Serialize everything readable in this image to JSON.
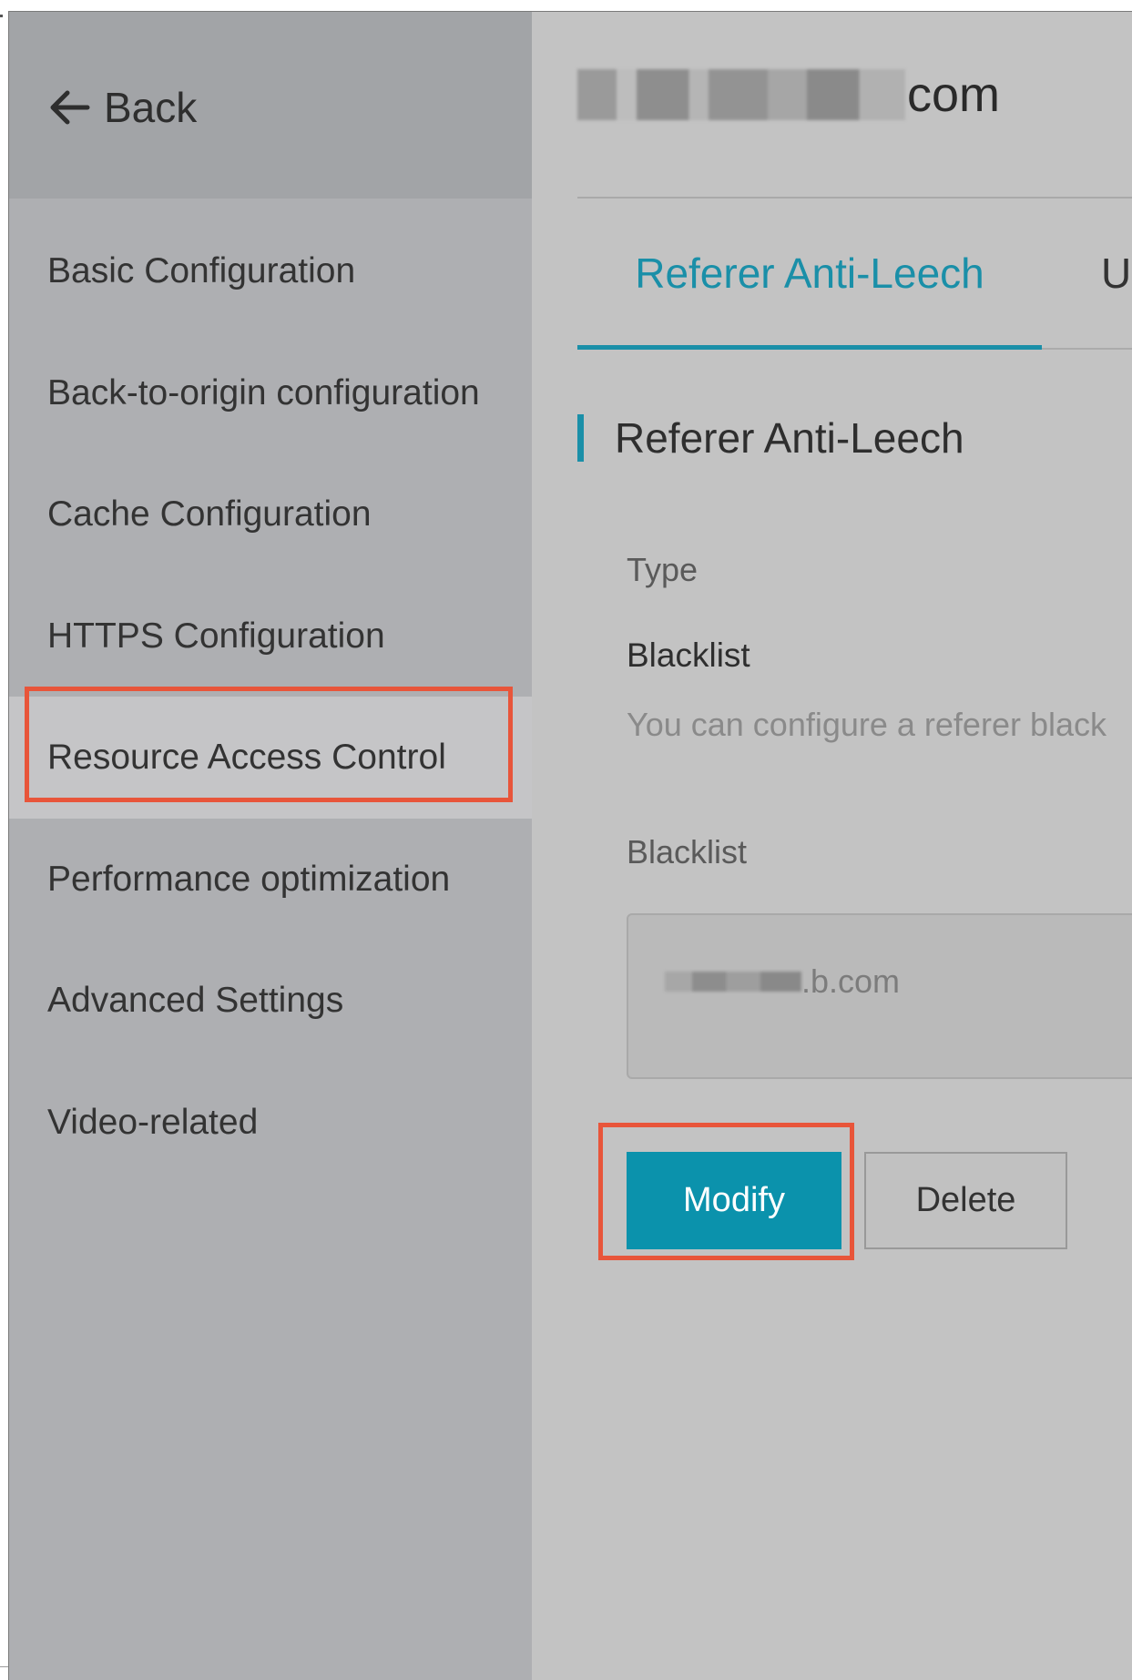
{
  "sidebar": {
    "back_label": "Back",
    "items": [
      {
        "label": "Basic Configuration"
      },
      {
        "label": "Back-to-origin configuration"
      },
      {
        "label": "Cache Configuration"
      },
      {
        "label": "HTTPS Configuration"
      },
      {
        "label": "Resource Access Control"
      },
      {
        "label": "Performance optimization"
      },
      {
        "label": "Advanced Settings"
      },
      {
        "label": "Video-related"
      }
    ],
    "active_item": "Resource Access Control"
  },
  "header": {
    "domain_suffix": "com",
    "status_icon": "check-circle-icon"
  },
  "tabs": [
    {
      "label": "Referer Anti-Leech"
    },
    {
      "label": "U"
    }
  ],
  "section": {
    "title": "Referer Anti-Leech",
    "type_label": "Type",
    "type_value": "Blacklist",
    "hint": "You can configure a referer black",
    "blacklist_label": "Blacklist",
    "blacklist_value_suffix": ".b.com"
  },
  "actions": {
    "modify_label": "Modify",
    "delete_label": "Delete"
  },
  "colors": {
    "accent": "#1a8fa8",
    "primary_button": "#0b92ac",
    "highlight": "#e8553a"
  }
}
